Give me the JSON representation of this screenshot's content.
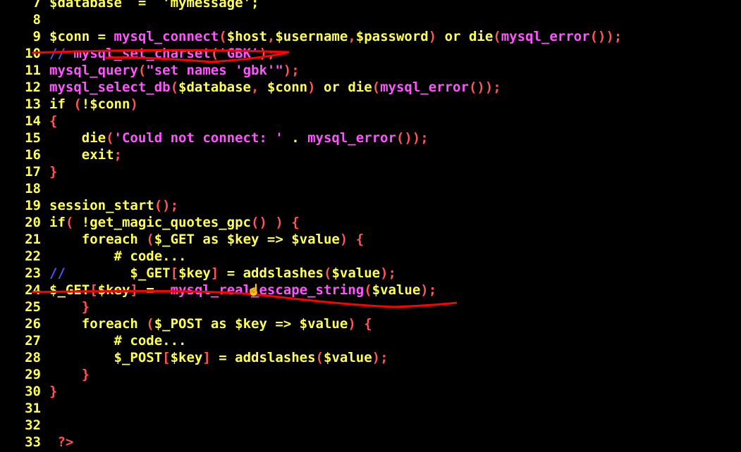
{
  "colors": {
    "background": "#000000",
    "line_number": "#FFFF55",
    "variable": "#FFFF55",
    "function": "#FF55FF",
    "keyword": "#FFFF55",
    "punctuation": "#FF5555",
    "string": "#FF55FF",
    "comment": "#5555FF",
    "annotation": "#ff0000"
  },
  "lines": [
    {
      "n": "7",
      "tokens": [
        {
          "t": "$database  =  'mymessage';",
          "c": "variable"
        }
      ]
    },
    {
      "n": "8",
      "tokens": []
    },
    {
      "n": "9",
      "tokens": [
        {
          "t": "$conn",
          "c": "variable"
        },
        {
          "t": " = ",
          "c": "variable"
        },
        {
          "t": "mysql_connect",
          "c": "function"
        },
        {
          "t": "(",
          "c": "punctuation"
        },
        {
          "t": "$host",
          "c": "variable"
        },
        {
          "t": ",",
          "c": "punctuation"
        },
        {
          "t": "$username",
          "c": "variable"
        },
        {
          "t": ",",
          "c": "punctuation"
        },
        {
          "t": "$password",
          "c": "variable"
        },
        {
          "t": ")",
          "c": "punctuation"
        },
        {
          "t": " or ",
          "c": "keyword"
        },
        {
          "t": "die",
          "c": "keyword"
        },
        {
          "t": "(",
          "c": "punctuation"
        },
        {
          "t": "mysql_error",
          "c": "function"
        },
        {
          "t": "());",
          "c": "punctuation"
        }
      ]
    },
    {
      "n": "10",
      "tokens": [
        {
          "t": "// ",
          "c": "comment"
        },
        {
          "t": "mysql_set_charset",
          "c": "function"
        },
        {
          "t": "(",
          "c": "punctuation"
        },
        {
          "t": "'GBK'",
          "c": "string"
        },
        {
          "t": ");",
          "c": "punctuation"
        }
      ]
    },
    {
      "n": "11",
      "tokens": [
        {
          "t": "mysql_query",
          "c": "function"
        },
        {
          "t": "(",
          "c": "punctuation"
        },
        {
          "t": "\"set names 'gbk'\"",
          "c": "string"
        },
        {
          "t": ");",
          "c": "punctuation"
        }
      ]
    },
    {
      "n": "12",
      "tokens": [
        {
          "t": "mysql_select_db",
          "c": "function"
        },
        {
          "t": "(",
          "c": "punctuation"
        },
        {
          "t": "$database",
          "c": "variable"
        },
        {
          "t": ", ",
          "c": "punctuation"
        },
        {
          "t": "$conn",
          "c": "variable"
        },
        {
          "t": ")",
          "c": "punctuation"
        },
        {
          "t": " or ",
          "c": "keyword"
        },
        {
          "t": "die",
          "c": "keyword"
        },
        {
          "t": "(",
          "c": "punctuation"
        },
        {
          "t": "mysql_error",
          "c": "function"
        },
        {
          "t": "());",
          "c": "punctuation"
        }
      ]
    },
    {
      "n": "13",
      "tokens": [
        {
          "t": "if",
          "c": "keyword"
        },
        {
          "t": " (",
          "c": "punctuation"
        },
        {
          "t": "!",
          "c": "keyword"
        },
        {
          "t": "$conn",
          "c": "variable"
        },
        {
          "t": ")",
          "c": "punctuation"
        }
      ]
    },
    {
      "n": "14",
      "tokens": [
        {
          "t": "{",
          "c": "punctuation"
        }
      ]
    },
    {
      "n": "15",
      "tokens": [
        {
          "t": "    die",
          "c": "keyword"
        },
        {
          "t": "(",
          "c": "punctuation"
        },
        {
          "t": "'Could not connect: '",
          "c": "string"
        },
        {
          "t": " . ",
          "c": "keyword"
        },
        {
          "t": "mysql_error",
          "c": "function"
        },
        {
          "t": "());",
          "c": "punctuation"
        }
      ]
    },
    {
      "n": "16",
      "tokens": [
        {
          "t": "    exit",
          "c": "keyword"
        },
        {
          "t": ";",
          "c": "punctuation"
        }
      ]
    },
    {
      "n": "17",
      "tokens": [
        {
          "t": "}",
          "c": "punctuation"
        }
      ]
    },
    {
      "n": "18",
      "tokens": []
    },
    {
      "n": "19",
      "tokens": [
        {
          "t": "session_start",
          "c": "keyword"
        },
        {
          "t": "();",
          "c": "punctuation"
        }
      ]
    },
    {
      "n": "20",
      "tokens": [
        {
          "t": "if",
          "c": "keyword"
        },
        {
          "t": "( ",
          "c": "punctuation"
        },
        {
          "t": "!get_magic_quotes_gpc",
          "c": "keyword"
        },
        {
          "t": "() ) {",
          "c": "punctuation"
        }
      ]
    },
    {
      "n": "21",
      "tokens": [
        {
          "t": "    foreach",
          "c": "keyword"
        },
        {
          "t": " (",
          "c": "punctuation"
        },
        {
          "t": "$_GET",
          "c": "variable"
        },
        {
          "t": " as ",
          "c": "keyword"
        },
        {
          "t": "$key",
          "c": "variable"
        },
        {
          "t": " => ",
          "c": "keyword"
        },
        {
          "t": "$value",
          "c": "variable"
        },
        {
          "t": ") {",
          "c": "punctuation"
        }
      ]
    },
    {
      "n": "22",
      "tokens": [
        {
          "t": "        # code...",
          "c": "variable"
        }
      ]
    },
    {
      "n": "23",
      "tokens": [
        {
          "t": "//",
          "c": "comment"
        },
        {
          "t": "        $_GET",
          "c": "variable"
        },
        {
          "t": "[",
          "c": "punctuation"
        },
        {
          "t": "$key",
          "c": "variable"
        },
        {
          "t": "]",
          "c": "punctuation"
        },
        {
          "t": " = ",
          "c": "keyword"
        },
        {
          "t": "addslashes",
          "c": "keyword"
        },
        {
          "t": "(",
          "c": "punctuation"
        },
        {
          "t": "$value",
          "c": "variable"
        },
        {
          "t": ");",
          "c": "punctuation"
        }
      ]
    },
    {
      "n": "24",
      "tokens": [
        {
          "t": "$_GET",
          "c": "variable"
        },
        {
          "t": "[",
          "c": "punctuation"
        },
        {
          "t": "$key",
          "c": "variable"
        },
        {
          "t": "]",
          "c": "punctuation"
        },
        {
          "t": " =  ",
          "c": "keyword"
        },
        {
          "t": "mysql_real_escape_string",
          "c": "function"
        },
        {
          "t": "(",
          "c": "punctuation"
        },
        {
          "t": "$value",
          "c": "variable"
        },
        {
          "t": ");",
          "c": "punctuation"
        }
      ]
    },
    {
      "n": "25",
      "tokens": [
        {
          "t": "    }",
          "c": "punctuation"
        }
      ]
    },
    {
      "n": "26",
      "tokens": [
        {
          "t": "    foreach",
          "c": "keyword"
        },
        {
          "t": " (",
          "c": "punctuation"
        },
        {
          "t": "$_POST",
          "c": "variable"
        },
        {
          "t": " as ",
          "c": "keyword"
        },
        {
          "t": "$key",
          "c": "variable"
        },
        {
          "t": " => ",
          "c": "keyword"
        },
        {
          "t": "$value",
          "c": "variable"
        },
        {
          "t": ") {",
          "c": "punctuation"
        }
      ]
    },
    {
      "n": "27",
      "tokens": [
        {
          "t": "        # code...",
          "c": "variable"
        }
      ]
    },
    {
      "n": "28",
      "tokens": [
        {
          "t": "        $_POST",
          "c": "variable"
        },
        {
          "t": "[",
          "c": "punctuation"
        },
        {
          "t": "$key",
          "c": "variable"
        },
        {
          "t": "]",
          "c": "punctuation"
        },
        {
          "t": " = ",
          "c": "keyword"
        },
        {
          "t": "addslashes",
          "c": "keyword"
        },
        {
          "t": "(",
          "c": "punctuation"
        },
        {
          "t": "$value",
          "c": "variable"
        },
        {
          "t": ");",
          "c": "punctuation"
        }
      ]
    },
    {
      "n": "29",
      "tokens": [
        {
          "t": "    }",
          "c": "punctuation"
        }
      ]
    },
    {
      "n": "30",
      "tokens": [
        {
          "t": "}",
          "c": "punctuation"
        }
      ]
    },
    {
      "n": "31",
      "tokens": []
    },
    {
      "n": "32",
      "tokens": []
    },
    {
      "n": "33",
      "tokens": [
        {
          "t": " ?>",
          "c": "punctuation"
        }
      ]
    }
  ]
}
